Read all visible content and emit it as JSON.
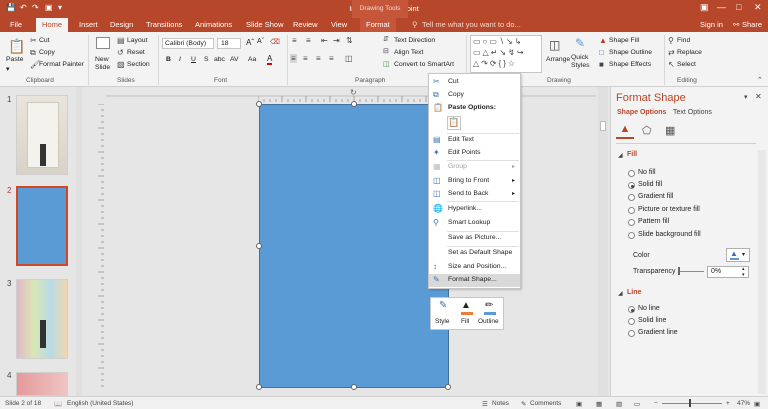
{
  "window": {
    "title": "Images - PowerPoint",
    "drawing_tools": "Drawing Tools",
    "sign_in": "Sign in",
    "share": "Share",
    "tell_me": "Tell me what you want to do..."
  },
  "tabs": [
    "File",
    "Home",
    "Insert",
    "Design",
    "Transitions",
    "Animations",
    "Slide Show",
    "Review",
    "View",
    "Format"
  ],
  "ribbon": {
    "clipboard": {
      "paste": "Paste",
      "cut": "Cut",
      "copy": "Copy",
      "format_painter": "Format Painter",
      "label": "Clipboard"
    },
    "slides": {
      "new_slide": "New Slide",
      "layout": "Layout",
      "reset": "Reset",
      "section": "Section",
      "label": "Slides"
    },
    "font": {
      "font_name": "Calibri (Body)",
      "font_size": "18",
      "label": "Font",
      "bold": "B",
      "italic": "I",
      "underline": "U",
      "strike": "S",
      "shadow": "abc",
      "spacing": "AV",
      "case": "Aa",
      "color": "A"
    },
    "paragraph": {
      "text_direction": "Text Direction",
      "align_text": "Align Text",
      "convert_smartart": "Convert to SmartArt",
      "label": "Paragraph"
    },
    "drawing": {
      "arrange": "Arrange",
      "quick_styles": "Quick Styles",
      "shape_fill": "Shape Fill",
      "shape_outline": "Shape Outline",
      "shape_effects": "Shape Effects",
      "label": "Drawing"
    },
    "editing": {
      "find": "Find",
      "replace": "Replace",
      "select": "Select",
      "label": "Editing"
    }
  },
  "slides": [
    {
      "num": "1"
    },
    {
      "num": "2"
    },
    {
      "num": "3"
    },
    {
      "num": "4"
    }
  ],
  "context_menu": {
    "items": [
      {
        "label": "Cut",
        "icon": "cut-icon",
        "disabled": false
      },
      {
        "label": "Copy",
        "icon": "copy-icon",
        "disabled": false
      },
      {
        "label": "Paste Options:",
        "icon": "paste-icon",
        "disabled": false
      },
      {
        "label": "Edit Text",
        "icon": "edit-text-icon",
        "disabled": false
      },
      {
        "label": "Edit Points",
        "icon": "edit-points-icon",
        "disabled": false
      },
      {
        "label": "Group",
        "icon": "group-icon",
        "disabled": true
      },
      {
        "label": "Bring to Front",
        "icon": "bring-front-icon",
        "disabled": false
      },
      {
        "label": "Send to Back",
        "icon": "send-back-icon",
        "disabled": false
      },
      {
        "label": "Hyperlink...",
        "icon": "hyperlink-icon",
        "disabled": false
      },
      {
        "label": "Smart Lookup",
        "icon": "search-icon",
        "disabled": false
      },
      {
        "label": "Save as Picture...",
        "icon": "",
        "disabled": false
      },
      {
        "label": "Set as Default Shape",
        "icon": "",
        "disabled": false
      },
      {
        "label": "Size and Position...",
        "icon": "size-icon",
        "disabled": false
      },
      {
        "label": "Format Shape...",
        "icon": "format-shape-icon",
        "disabled": false
      }
    ]
  },
  "mini_toolbar": {
    "style": "Style",
    "fill": "Fill",
    "outline": "Outline"
  },
  "format_pane": {
    "title": "Format Shape",
    "tab_shape": "Shape Options",
    "tab_text": "Text Options",
    "fill_section": "Fill",
    "fill_options": [
      "No fill",
      "Solid fill",
      "Gradient fill",
      "Picture or texture fill",
      "Pattern fill",
      "Slide background fill"
    ],
    "fill_selected": 1,
    "color_label": "Color",
    "transparency_label": "Transparency",
    "transparency_value": "0%",
    "line_section": "Line",
    "line_options": [
      "No line",
      "Solid line",
      "Gradient line"
    ],
    "line_selected": 0
  },
  "status": {
    "slide": "Slide 2 of 18",
    "language": "English (United States)",
    "notes": "Notes",
    "comments": "Comments",
    "zoom": "47%"
  },
  "colors": {
    "brand": "#b7472a",
    "shape_fill": "#5b9bd5",
    "accent": "#c6563a"
  }
}
